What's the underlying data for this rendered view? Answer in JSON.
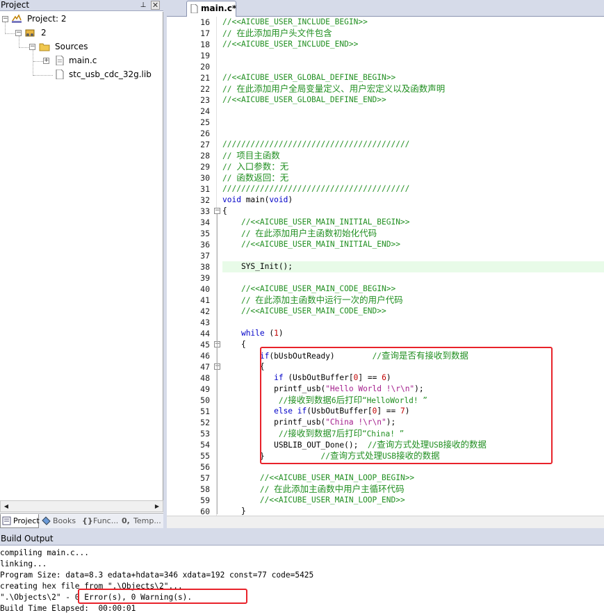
{
  "project_panel": {
    "title": "Project",
    "pin_icon": "pin-icon",
    "close_icon": "close-icon",
    "tree": {
      "root": "Project: 2",
      "target": "2",
      "group": "Sources",
      "files": [
        "main.c",
        "stc_usb_cdc_32g.lib"
      ]
    },
    "tabs": [
      "Project",
      "Books",
      "Func...",
      "Temp..."
    ]
  },
  "editor": {
    "tab_label": "main.c*",
    "lines": [
      {
        "n": "16",
        "t": "//<<AICUBE_USER_INCLUDE_BEGIN>>"
      },
      {
        "n": "17",
        "t": "// 在此添加用户头文件包含"
      },
      {
        "n": "18",
        "t": "//<<AICUBE_USER_INCLUDE_END>>"
      },
      {
        "n": "19",
        "t": ""
      },
      {
        "n": "20",
        "t": ""
      },
      {
        "n": "21",
        "t": "//<<AICUBE_USER_GLOBAL_DEFINE_BEGIN>>"
      },
      {
        "n": "22",
        "t": "// 在此添加用户全局变量定义、用户宏定义以及函数声明"
      },
      {
        "n": "23",
        "t": "//<<AICUBE_USER_GLOBAL_DEFINE_END>>"
      },
      {
        "n": "24",
        "t": ""
      },
      {
        "n": "25",
        "t": ""
      },
      {
        "n": "26",
        "t": ""
      },
      {
        "n": "27",
        "t": "////////////////////////////////////////"
      },
      {
        "n": "28",
        "t": "// 项目主函数"
      },
      {
        "n": "29",
        "t": "// 入口参数：无"
      },
      {
        "n": "30",
        "t": "// 函数返回：无"
      },
      {
        "n": "31",
        "t": "////////////////////////////////////////"
      },
      {
        "n": "32",
        "t": "void main(void)"
      },
      {
        "n": "33",
        "t": "{"
      },
      {
        "n": "34",
        "t": "    //<<AICUBE_USER_MAIN_INITIAL_BEGIN>>"
      },
      {
        "n": "35",
        "t": "    // 在此添加用户主函数初始化代码"
      },
      {
        "n": "36",
        "t": "    //<<AICUBE_USER_MAIN_INITIAL_END>>"
      },
      {
        "n": "37",
        "t": ""
      },
      {
        "n": "38",
        "t": "    SYS_Init();"
      },
      {
        "n": "39",
        "t": ""
      },
      {
        "n": "40",
        "t": "    //<<AICUBE_USER_MAIN_CODE_BEGIN>>"
      },
      {
        "n": "41",
        "t": "    // 在此添加主函数中运行一次的用户代码"
      },
      {
        "n": "42",
        "t": "    //<<AICUBE_USER_MAIN_CODE_END>>"
      },
      {
        "n": "43",
        "t": ""
      },
      {
        "n": "44",
        "t": "    while (1)"
      },
      {
        "n": "45",
        "t": "    {"
      },
      {
        "n": "46",
        "t": "        if(bUsbOutReady)        //查询是否有接收到数据"
      },
      {
        "n": "47",
        "t": "        {"
      },
      {
        "n": "48",
        "t": "           if (UsbOutBuffer[0] == 6)"
      },
      {
        "n": "49",
        "t": "           printf_usb(\"Hello World !\\r\\n\");"
      },
      {
        "n": "50",
        "t": "            //接收到数据6后打印“HelloWorld! ”"
      },
      {
        "n": "51",
        "t": "           else if(UsbOutBuffer[0] == 7)"
      },
      {
        "n": "52",
        "t": "           printf_usb(\"China !\\r\\n\");"
      },
      {
        "n": "53",
        "t": "            //接收到数据7后打印“China! ”"
      },
      {
        "n": "54",
        "t": "           USBLIB_OUT_Done();  //查询方式处理USB接收的数据"
      },
      {
        "n": "55",
        "t": "        }            //查询方式处理USB接收的数据"
      },
      {
        "n": "56",
        "t": ""
      },
      {
        "n": "57",
        "t": "        //<<AICUBE_USER_MAIN_LOOP_BEGIN>>"
      },
      {
        "n": "58",
        "t": "        // 在此添加主函数中用户主循环代码"
      },
      {
        "n": "59",
        "t": "        //<<AICUBE_USER_MAIN_LOOP_END>>"
      },
      {
        "n": "60",
        "t": "    }"
      }
    ]
  },
  "build_output": {
    "title": "Build Output",
    "lines": [
      "compiling main.c...",
      "linking...",
      "Program Size: data=8.3 edata+hdata=346 xdata=192 const=77 code=5425",
      "creating hex file from \".\\Objects\\2\"...",
      "\".\\Objects\\2\" - 0 Error(s), 0 Warning(s).",
      "Build Time Elapsed:  00:00:01"
    ]
  },
  "colors": {
    "comment": "#218f21",
    "keyword": "#0000c8",
    "string": "#a31e8c",
    "highlight_line": "#e8fbe8",
    "annotation_box": "#e8222a"
  }
}
